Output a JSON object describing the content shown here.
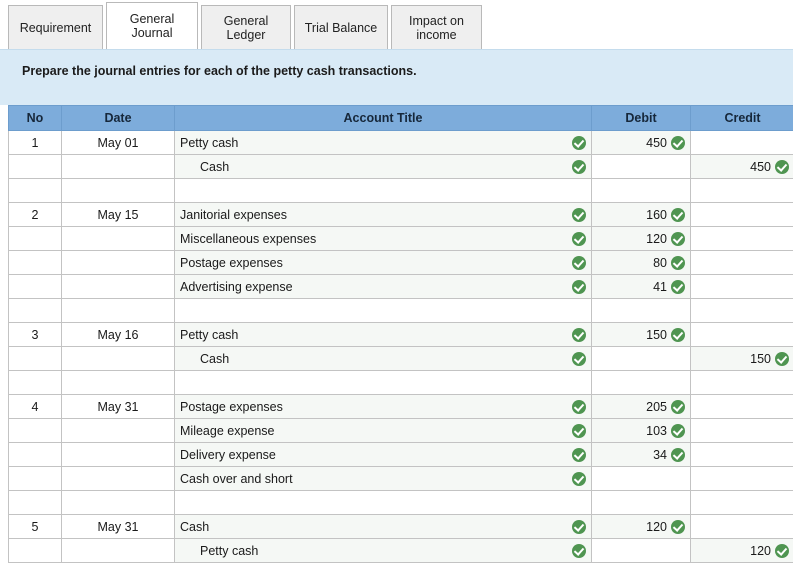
{
  "tabs": [
    {
      "label": "Requirement",
      "active": false,
      "name": "tab-requirement"
    },
    {
      "label": "General\nJournal",
      "active": true,
      "name": "tab-general-journal"
    },
    {
      "label": "General\nLedger",
      "active": false,
      "name": "tab-general-ledger"
    },
    {
      "label": "Trial Balance",
      "active": false,
      "name": "tab-trial-balance"
    },
    {
      "label": "Impact on\nincome",
      "active": false,
      "name": "tab-impact-on-income"
    }
  ],
  "instruction": {
    "text": "Prepare the journal entries for each of the petty cash transactions."
  },
  "table": {
    "columns": [
      "No",
      "Date",
      "Account Title",
      "Debit",
      "Credit"
    ],
    "rows": [
      {
        "type": "entry",
        "no": "1",
        "date": "May 01",
        "account": "Petty cash",
        "indent": false,
        "debit": "450",
        "credit": "",
        "check_account": true,
        "check_debit": true,
        "check_credit": false
      },
      {
        "type": "entry",
        "no": "",
        "date": "",
        "account": "Cash",
        "indent": true,
        "debit": "",
        "credit": "450",
        "check_account": true,
        "check_debit": false,
        "check_credit": true
      },
      {
        "type": "spacer",
        "no": "",
        "date": "",
        "account": "",
        "indent": false,
        "debit": "",
        "credit": "",
        "check_account": false,
        "check_debit": false,
        "check_credit": false
      },
      {
        "type": "entry",
        "no": "2",
        "date": "May 15",
        "account": "Janitorial expenses",
        "indent": false,
        "debit": "160",
        "credit": "",
        "check_account": true,
        "check_debit": true,
        "check_credit": false
      },
      {
        "type": "entry",
        "no": "",
        "date": "",
        "account": "Miscellaneous expenses",
        "indent": false,
        "debit": "120",
        "credit": "",
        "check_account": true,
        "check_debit": true,
        "check_credit": false
      },
      {
        "type": "entry",
        "no": "",
        "date": "",
        "account": "Postage expenses",
        "indent": false,
        "debit": "80",
        "credit": "",
        "check_account": true,
        "check_debit": true,
        "check_credit": false
      },
      {
        "type": "entry",
        "no": "",
        "date": "",
        "account": "Advertising expense",
        "indent": false,
        "debit": "41",
        "credit": "",
        "check_account": true,
        "check_debit": true,
        "check_credit": false
      },
      {
        "type": "spacer",
        "no": "",
        "date": "",
        "account": "",
        "indent": false,
        "debit": "",
        "credit": "",
        "check_account": false,
        "check_debit": false,
        "check_credit": false
      },
      {
        "type": "entry",
        "no": "3",
        "date": "May 16",
        "account": "Petty cash",
        "indent": false,
        "debit": "150",
        "credit": "",
        "check_account": true,
        "check_debit": true,
        "check_credit": false
      },
      {
        "type": "entry",
        "no": "",
        "date": "",
        "account": "Cash",
        "indent": true,
        "debit": "",
        "credit": "150",
        "check_account": true,
        "check_debit": false,
        "check_credit": true
      },
      {
        "type": "spacer",
        "no": "",
        "date": "",
        "account": "",
        "indent": false,
        "debit": "",
        "credit": "",
        "check_account": false,
        "check_debit": false,
        "check_credit": false
      },
      {
        "type": "entry",
        "no": "4",
        "date": "May 31",
        "account": "Postage expenses",
        "indent": false,
        "debit": "205",
        "credit": "",
        "check_account": true,
        "check_debit": true,
        "check_credit": false
      },
      {
        "type": "entry",
        "no": "",
        "date": "",
        "account": "Mileage expense",
        "indent": false,
        "debit": "103",
        "credit": "",
        "check_account": true,
        "check_debit": true,
        "check_credit": false
      },
      {
        "type": "entry",
        "no": "",
        "date": "",
        "account": "Delivery expense",
        "indent": false,
        "debit": "34",
        "credit": "",
        "check_account": true,
        "check_debit": true,
        "check_credit": false
      },
      {
        "type": "entry",
        "no": "",
        "date": "",
        "account": "Cash over and short",
        "indent": false,
        "debit": "",
        "credit": "",
        "check_account": true,
        "check_debit": false,
        "check_credit": false
      },
      {
        "type": "spacer",
        "no": "",
        "date": "",
        "account": "",
        "indent": false,
        "debit": "",
        "credit": "",
        "check_account": false,
        "check_debit": false,
        "check_credit": false
      },
      {
        "type": "entry",
        "no": "5",
        "date": "May 31",
        "account": "Cash",
        "indent": false,
        "debit": "120",
        "credit": "",
        "check_account": true,
        "check_debit": true,
        "check_credit": false
      },
      {
        "type": "entry",
        "no": "",
        "date": "",
        "account": "Petty cash",
        "indent": true,
        "debit": "",
        "credit": "120",
        "check_account": true,
        "check_debit": false,
        "check_credit": true
      }
    ]
  },
  "colors": {
    "header_blue": "#7dacdb",
    "banner_blue": "#d9eaf6",
    "check_green": "#4f9551",
    "row_tint": "#f5f8f5",
    "tab_inactive": "#efefef"
  },
  "icons": {
    "check": "check-circle-icon"
  }
}
